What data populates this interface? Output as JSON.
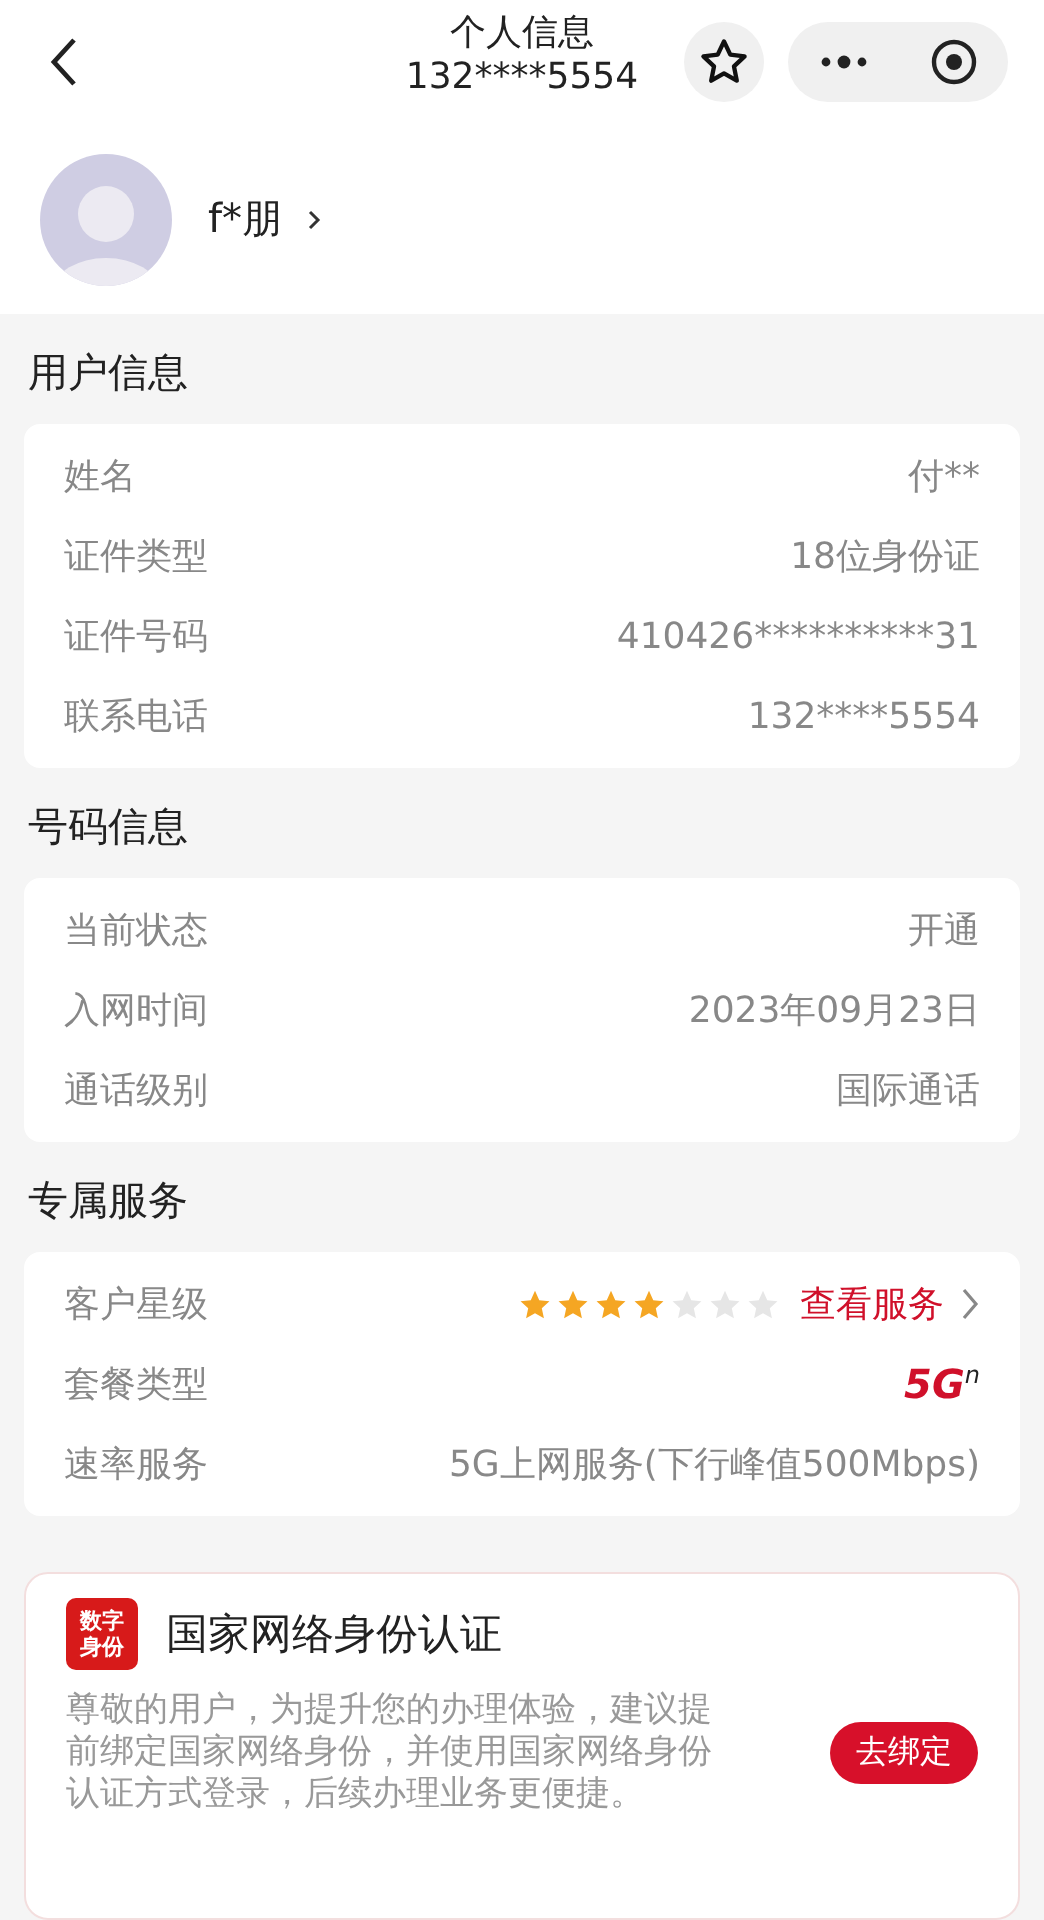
{
  "header": {
    "title": "个人信息",
    "subtitle": "132****5554"
  },
  "profile": {
    "name": "f*朋"
  },
  "sections": [
    {
      "title": "用户信息",
      "rows": [
        {
          "kind": "text",
          "label": "姓名",
          "value": "付**"
        },
        {
          "kind": "text",
          "label": "证件类型",
          "value": "18位身份证"
        },
        {
          "kind": "text",
          "label": "证件号码",
          "value": "410426**********31"
        },
        {
          "kind": "text",
          "label": "联系电话",
          "value": "132****5554"
        }
      ]
    },
    {
      "title": "号码信息",
      "rows": [
        {
          "kind": "text",
          "label": "当前状态",
          "value": "开通"
        },
        {
          "kind": "text",
          "label": "入网时间",
          "value": "2023年09月23日"
        },
        {
          "kind": "text",
          "label": "通话级别",
          "value": "国际通话"
        }
      ]
    },
    {
      "title": "专属服务",
      "rows": [
        {
          "kind": "stars",
          "label": "客户星级",
          "stars": 4,
          "link": "查看服务"
        },
        {
          "kind": "badge",
          "label": "套餐类型",
          "value": "5G$^{n}$"
        },
        {
          "kind": "text",
          "label": "速率服务",
          "value": "5G上网服务(下行峰值500Mbps)"
        }
      ]
    }
  ],
  "banner": {
    "logo_text": "数字身份",
    "title": "国家网络身份认证",
    "body": "尊敬的用户，为提升您的办理体验，建议提前绑定国家网络身份，并使用国家网络身份认证方式登录，后续办理业务更便捷。",
    "button": "去绑定"
  }
}
